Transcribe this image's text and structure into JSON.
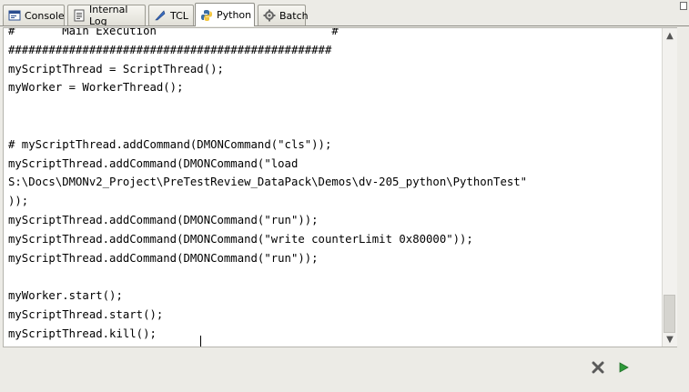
{
  "tabs": [
    {
      "label": "Console",
      "icon": "console-icon",
      "active": false
    },
    {
      "label": "Internal Log",
      "icon": "log-icon",
      "active": false
    },
    {
      "label": "TCL",
      "icon": "tcl-feather-icon",
      "active": false
    },
    {
      "label": "Python",
      "icon": "python-icon",
      "active": true
    },
    {
      "label": "Batch",
      "icon": "batch-icon",
      "active": false
    }
  ],
  "editor": {
    "lines": [
      "#       Main Execution                          #",
      "################################################",
      "myScriptThread = ScriptThread();",
      "myWorker = WorkerThread();",
      "",
      "",
      "# myScriptThread.addCommand(DMONCommand(\"cls\"));",
      "myScriptThread.addCommand(DMONCommand(\"load",
      "S:\\Docs\\DMONv2_Project\\PreTestReview_DataPack\\Demos\\dv-205_python\\PythonTest\"",
      "));",
      "myScriptThread.addCommand(DMONCommand(\"run\"));",
      "myScriptThread.addCommand(DMONCommand(\"write counterLimit 0x80000\"));",
      "myScriptThread.addCommand(DMONCommand(\"run\"));",
      "",
      "myWorker.start();",
      "myScriptThread.start();",
      "myScriptThread.kill();"
    ]
  },
  "scrollbar": {
    "up_arrow": "▲",
    "down_arrow": "▼"
  },
  "actions": {
    "clear_icon": "clear-x-icon",
    "run_icon": "run-play-icon"
  },
  "colors": {
    "run": "#2e9a3a",
    "clear": "#5a5a5a",
    "python_blue": "#3a6ea5",
    "python_yellow": "#f2c53d"
  }
}
